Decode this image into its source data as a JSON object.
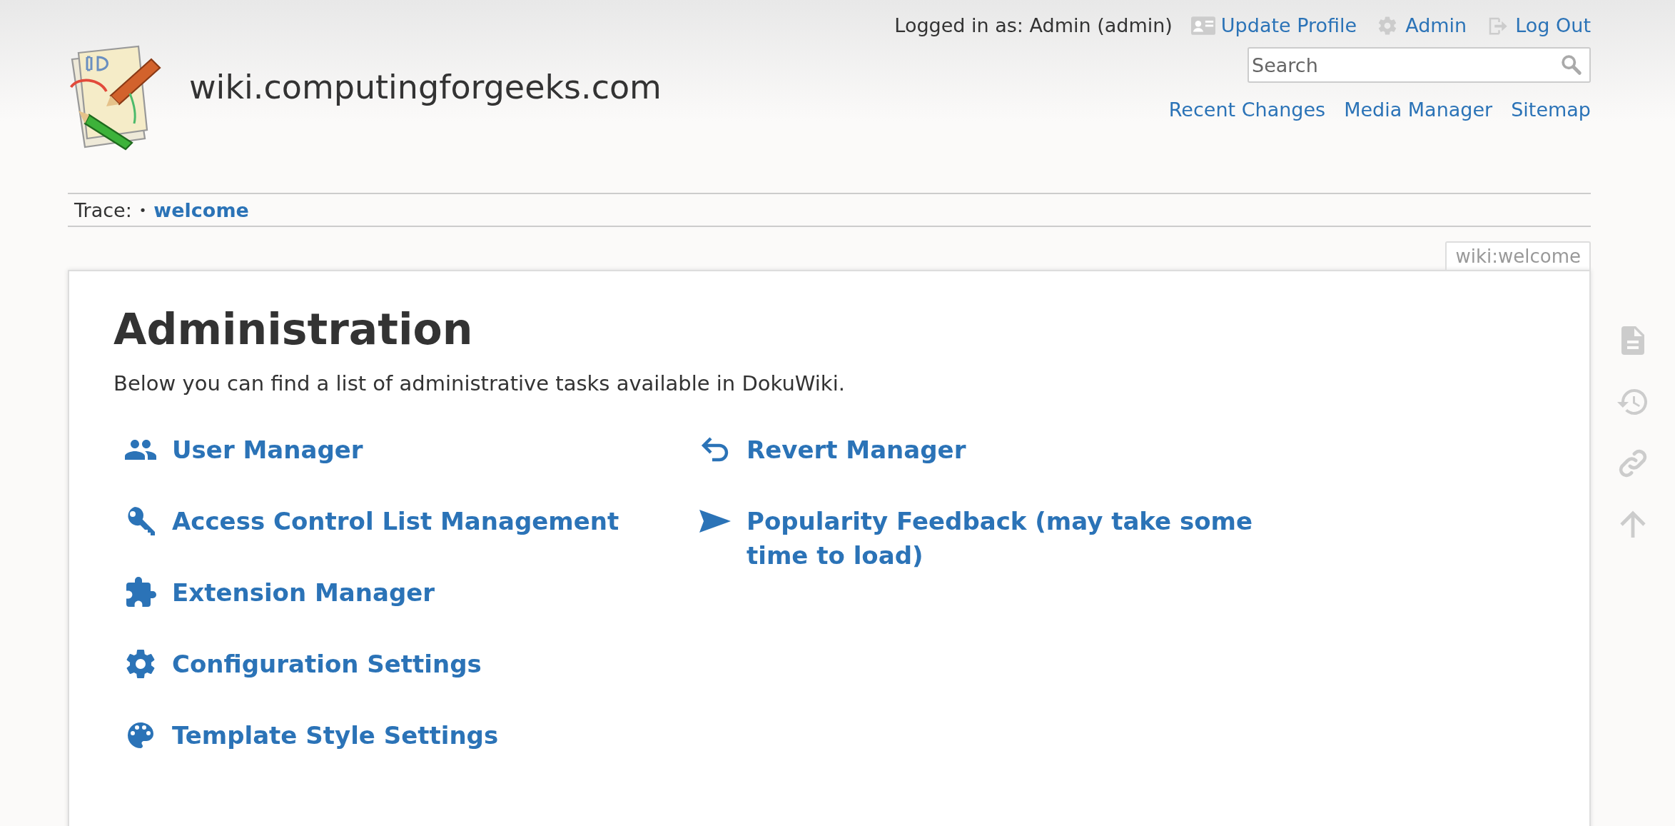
{
  "site_title": "wiki.computingforgeeks.com",
  "user_bar": {
    "logged_in_text": "Logged in as: Admin (admin)",
    "links": [
      "Update Profile",
      "Admin",
      "Log Out"
    ]
  },
  "search": {
    "placeholder": "Search"
  },
  "nav_links": [
    "Recent Changes",
    "Media Manager",
    "Sitemap"
  ],
  "breadcrumb": {
    "label": "Trace:",
    "separator": "•",
    "items": [
      "welcome"
    ]
  },
  "page_id": "wiki:welcome",
  "heading": "Administration",
  "intro": "Below you can find a list of administrative tasks available in DokuWiki.",
  "admin_columns": [
    [
      "User Manager",
      "Access Control List Management",
      "Extension Manager",
      "Configuration Settings",
      "Template Style Settings"
    ],
    [
      "Revert Manager",
      "Popularity Feedback (may take some time to load)"
    ]
  ]
}
